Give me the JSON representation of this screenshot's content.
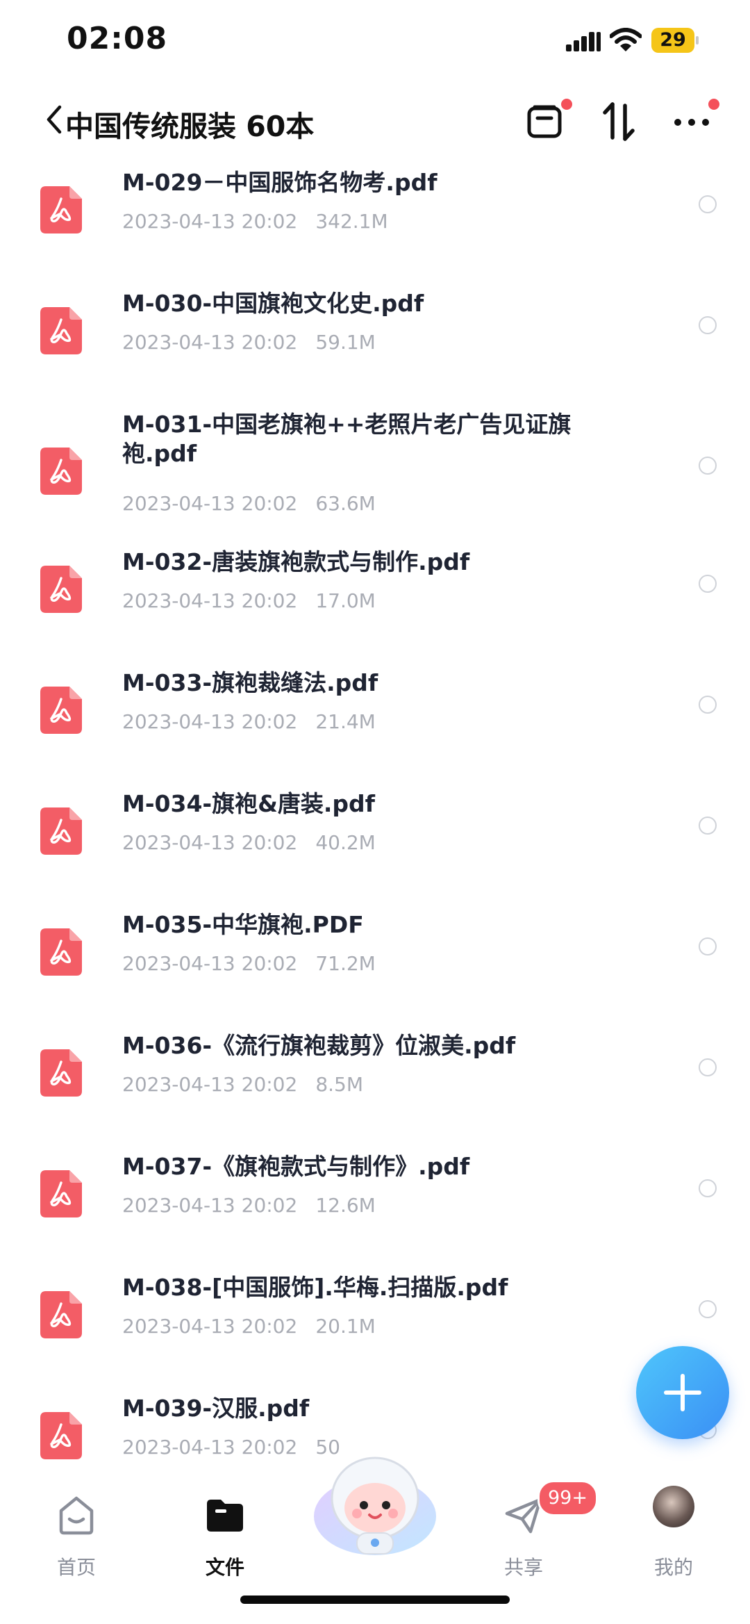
{
  "status_bar": {
    "time": "02:08",
    "battery": "29"
  },
  "header": {
    "title": "中国传统服装 60本",
    "actions": [
      "clipboard-icon",
      "sort-icon",
      "more-icon"
    ]
  },
  "files": [
    {
      "name": "M-029－中国服饰名物考.pdf",
      "date": "2023-04-13 20:02",
      "size": "342.1M"
    },
    {
      "name": "M-030-中国旗袍文化史.pdf",
      "date": "2023-04-13 20:02",
      "size": "59.1M"
    },
    {
      "name": "M-031-中国老旗袍++老照片老广告见证旗袍.pdf",
      "date": "2023-04-13 20:02",
      "size": "63.6M"
    },
    {
      "name": "M-032-唐装旗袍款式与制作.pdf",
      "date": "2023-04-13 20:02",
      "size": "17.0M"
    },
    {
      "name": "M-033-旗袍裁缝法.pdf",
      "date": "2023-04-13 20:02",
      "size": "21.4M"
    },
    {
      "name": "M-034-旗袍&唐装.pdf",
      "date": "2023-04-13 20:02",
      "size": "40.2M"
    },
    {
      "name": "M-035-中华旗袍.PDF",
      "date": "2023-04-13 20:02",
      "size": "71.2M"
    },
    {
      "name": "M-036-《流行旗袍裁剪》位淑美.pdf",
      "date": "2023-04-13 20:02",
      "size": "8.5M"
    },
    {
      "name": "M-037-《旗袍款式与制作》.pdf",
      "date": "2023-04-13 20:02",
      "size": "12.6M"
    },
    {
      "name": "M-038-[中国服饰].华梅.扫描版.pdf",
      "date": "2023-04-13 20:02",
      "size": "20.1M"
    },
    {
      "name": "M-039-汉服.pdf",
      "date": "2023-04-13 20:02",
      "size": "50"
    }
  ],
  "tab_bar": {
    "items": [
      {
        "label": "首页",
        "icon": "home-icon",
        "active": false
      },
      {
        "label": "文件",
        "icon": "folder-icon",
        "active": true
      },
      {
        "label": "",
        "icon": "assistant-mascot",
        "active": false
      },
      {
        "label": "共享",
        "icon": "share-icon",
        "active": false
      },
      {
        "label": "我的",
        "icon": "avatar",
        "active": false
      }
    ],
    "share_badge": "99+"
  },
  "colors": {
    "pdf_icon": "#f35d66",
    "fab": "#3a8ff5",
    "badge": "#f45b64",
    "meta_text": "#a9acb4"
  }
}
